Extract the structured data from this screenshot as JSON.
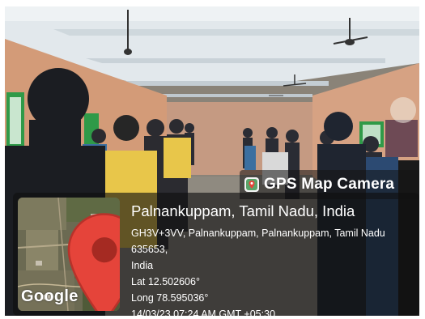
{
  "overlay": {
    "app_name": "GPS Map Camera",
    "location_title": "Palnankuppam, Tamil Nadu, India",
    "address_line1": "GH3V+3VV, Palnankuppam, Palnankuppam, Tamil Nadu 635653,",
    "address_line2": "India",
    "latitude": "Lat 12.502606°",
    "longitude": "Long 78.595036°",
    "timestamp": "14/03/23 07:24 AM GMT +05:30",
    "map_brand": "Google"
  },
  "icons": {
    "app_icon": "gps-camera-icon",
    "map_pin": "map-pin-icon",
    "ceiling_fans": "ceiling-fan-icon"
  },
  "colors": {
    "pin_red": "#e5443a",
    "wall_orange": "#d8a07e",
    "ceiling": "#dfe6ea",
    "window_green": "#2f9a48",
    "shirt_yellow": "#e8c64a"
  }
}
